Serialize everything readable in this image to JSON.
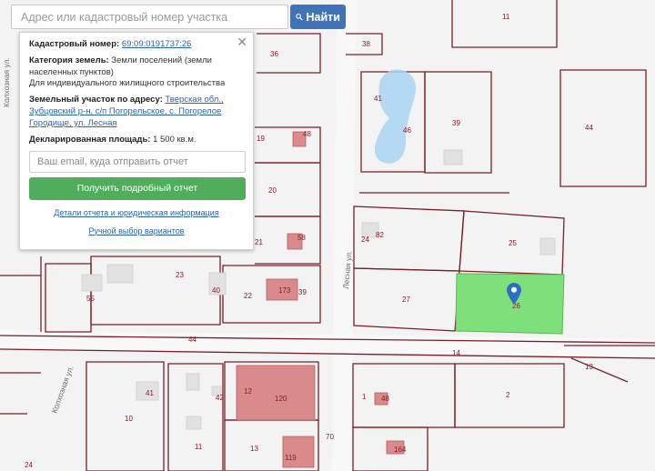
{
  "search": {
    "placeholder": "Адрес или кадастровый номер участка",
    "button_label": "Найти"
  },
  "popup": {
    "cadastral_label": "Кадастровый номер:",
    "cadastral_value": "69:09:0191737:26",
    "category_label": "Категория земель:",
    "category_value": "Земли поселений (земли населенных пунктов)",
    "usage_value": "Для индивидуального жилищного строительства",
    "address_label": "Земельный участок по адресу:",
    "address_value": "Тверская обл., Зубцовский р-н, с/п Погорельское, с. Погорелое Городище, ул. Лесная",
    "area_label": "Декларированная площадь:",
    "area_value": "1 500 кв.м.",
    "email_placeholder": "Ваш email, куда отправить отчет",
    "report_button": "Получить подробный отчет",
    "details_link": "Детали отчета и юридическая информация",
    "manual_link": "Ручной выбор вариантов",
    "close_symbol": "✕"
  },
  "map": {
    "street_labels": [
      "Колхозная ул.",
      "Лесная ул.",
      "Колхозная ул."
    ],
    "plot_numbers": [
      "11",
      "38",
      "36",
      "41",
      "46",
      "39",
      "44",
      "19",
      "48",
      "20",
      "24",
      "82",
      "25",
      "21",
      "58",
      "23",
      "40",
      "22",
      "173",
      "39",
      "55",
      "27",
      "26",
      "44",
      "14",
      "13",
      "41",
      "42",
      "12",
      "120",
      "1",
      "48",
      "2",
      "10",
      "11",
      "13",
      "119",
      "70",
      "164",
      "24"
    ],
    "selected_color": "#7ee07a",
    "building_color": "#d98b8b",
    "pond_color": "#a9d3f2"
  }
}
